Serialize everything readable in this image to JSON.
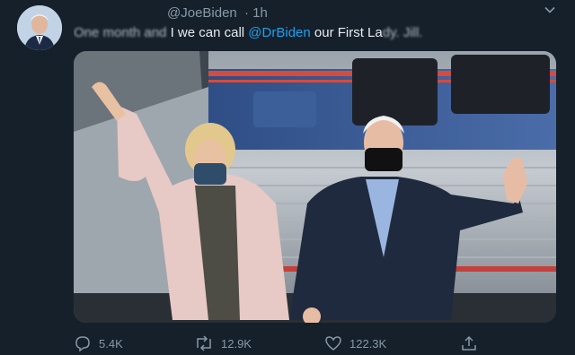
{
  "tweet": {
    "handle": "@JoeBiden",
    "time": "1h",
    "text_obscured_start": "One month and",
    "text_mid": "I we can call ",
    "mention": "@DrBiden",
    "text_end": " our First La",
    "text_obscured_end": "dy. Jill."
  },
  "actions": {
    "replies": "5.4K",
    "retweets": "12.9K",
    "likes": "122.3K"
  },
  "icons": {
    "reply": "reply-icon",
    "retweet": "retweet-icon",
    "like": "heart-icon",
    "share": "share-icon",
    "menu": "chevron-down-icon"
  },
  "colors": {
    "background": "#15202b",
    "accent": "#1da1f2",
    "muted": "#8899a6"
  }
}
